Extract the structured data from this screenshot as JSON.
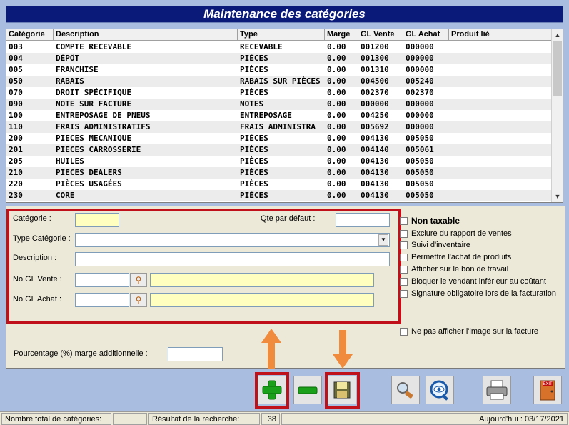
{
  "title": "Maintenance des catégories",
  "grid": {
    "headers": [
      "Catégorie",
      "Description",
      "Type",
      "Marge",
      "GL Vente",
      "GL Achat",
      "Produit lié"
    ],
    "rows": [
      [
        "003",
        "COMPTE RECEVABLE",
        "RECEVABLE",
        "0.00",
        "001200",
        "000000",
        ""
      ],
      [
        "004",
        "DÉPÔT",
        "PIÈCES",
        "0.00",
        "001300",
        "000000",
        ""
      ],
      [
        "005",
        "FRANCHISE",
        "PIÈCES",
        "0.00",
        "001310",
        "000000",
        ""
      ],
      [
        "050",
        "RABAIS",
        "RABAIS SUR PIÈCES",
        "0.00",
        "004500",
        "005240",
        ""
      ],
      [
        "070",
        "DROIT SPÉCIFIQUE",
        "PIÈCES",
        "0.00",
        "002370",
        "002370",
        ""
      ],
      [
        "090",
        "NOTE SUR FACTURE",
        "NOTES",
        "0.00",
        "000000",
        "000000",
        ""
      ],
      [
        "100",
        "ENTREPOSAGE DE PNEUS",
        "ENTREPOSAGE",
        "0.00",
        "004250",
        "000000",
        ""
      ],
      [
        "110",
        "FRAIS ADMINISTRATIFS",
        "FRAIS ADMINISTRA",
        "0.00",
        "005692",
        "000000",
        ""
      ],
      [
        "200",
        "PIECES MECANIQUE",
        "PIÈCES",
        "0.00",
        "004130",
        "005050",
        ""
      ],
      [
        "201",
        "PIECES CARROSSERIE",
        "PIÈCES",
        "0.00",
        "004140",
        "005061",
        ""
      ],
      [
        "205",
        "HUILES",
        "PIÈCES",
        "0.00",
        "004130",
        "005050",
        ""
      ],
      [
        "210",
        "PIECES DEALERS",
        "PIÈCES",
        "0.00",
        "004130",
        "005050",
        ""
      ],
      [
        "220",
        "PIÈCES USAGÉES",
        "PIÈCES",
        "0.00",
        "004130",
        "005050",
        ""
      ],
      [
        "230",
        "CORE",
        "PIÈCES",
        "0.00",
        "004130",
        "005050",
        ""
      ]
    ]
  },
  "form": {
    "categorie_label": "Catégorie :",
    "qte_label": "Qte par défaut :",
    "type_label": "Type Catégorie :",
    "description_label": "Description :",
    "gl_vente_label": "No GL Vente :",
    "gl_achat_label": "No GL Achat :",
    "pourcentage_label": "Pourcentage (%) marge additionnelle :"
  },
  "options": {
    "non_taxable": "Non taxable",
    "items": [
      "Exclure du rapport de ventes",
      "Suivi d'inventaire",
      "Permettre l'achat de produits",
      "Afficher sur le bon de travail",
      "Bloquer le vendant inférieur au coûtant",
      "Signature obligatoire lors de la facturation"
    ],
    "no_image": "Ne pas afficher l'image sur la facture"
  },
  "toolbar": {
    "icons": [
      "plus-icon",
      "minus-icon",
      "save-icon",
      "search-icon",
      "view-icon",
      "print-icon",
      "exit-icon"
    ],
    "exit_label": "EXIT",
    "accent": "#c0101a",
    "arrow_color": "#f08a3c"
  },
  "status": {
    "total_label": "Nombre total de catégories:",
    "total_value": "",
    "search_label": "Résultat de la recherche:",
    "search_value": "38",
    "date_label": "Aujourd'hui : 03/17/2021"
  }
}
